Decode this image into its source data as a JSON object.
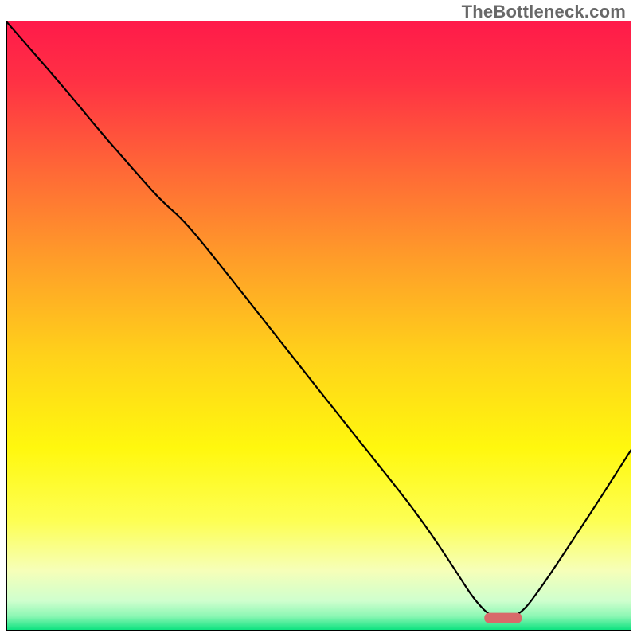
{
  "watermark": "TheBottleneck.com",
  "chart_data": {
    "type": "line",
    "title": "",
    "xlabel": "",
    "ylabel": "",
    "xlim": [
      0,
      100
    ],
    "ylim": [
      0,
      100
    ],
    "background": {
      "type": "vertical-gradient",
      "stops": [
        {
          "offset": 0.0,
          "color": "#ff1a4a"
        },
        {
          "offset": 0.1,
          "color": "#ff3144"
        },
        {
          "offset": 0.25,
          "color": "#ff6a36"
        },
        {
          "offset": 0.4,
          "color": "#ffa028"
        },
        {
          "offset": 0.55,
          "color": "#ffd21a"
        },
        {
          "offset": 0.7,
          "color": "#fff80e"
        },
        {
          "offset": 0.82,
          "color": "#fdff54"
        },
        {
          "offset": 0.9,
          "color": "#f6ffb8"
        },
        {
          "offset": 0.95,
          "color": "#cfffce"
        },
        {
          "offset": 0.975,
          "color": "#8cf7b4"
        },
        {
          "offset": 1.0,
          "color": "#00e07a"
        }
      ]
    },
    "series": [
      {
        "name": "curve",
        "x": [
          0.0,
          3.0,
          7.0,
          11.0,
          15.0,
          19.0,
          22.0,
          25.0,
          28.6,
          34.0,
          40.0,
          46.0,
          52.0,
          58.0,
          64.0,
          68.0,
          72.0,
          75.0,
          78.0,
          82.0,
          86.0,
          90.0,
          94.0,
          97.0,
          100.0
        ],
        "y": [
          100.0,
          96.5,
          91.8,
          87.0,
          82.0,
          77.3,
          73.8,
          70.4,
          67.2,
          60.4,
          52.6,
          44.8,
          37.0,
          29.3,
          21.6,
          16.0,
          9.8,
          5.0,
          2.0,
          2.3,
          7.8,
          14.0,
          20.2,
          25.0,
          29.8
        ]
      }
    ],
    "markers": [
      {
        "name": "target-bar",
        "shape": "rounded-rect",
        "color": "#d86a6a",
        "x_range": [
          76.5,
          82.5
        ],
        "y": 2.2
      }
    ]
  }
}
